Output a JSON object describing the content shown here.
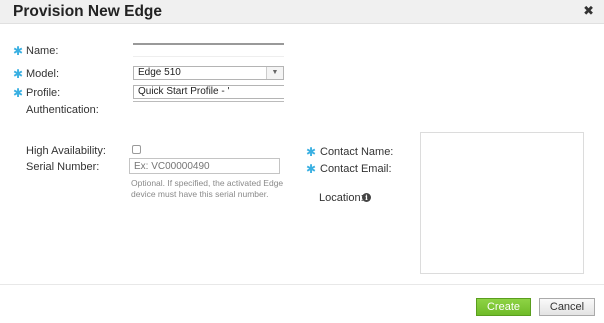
{
  "dialog": {
    "title": "Provision New Edge",
    "close_glyph": "✖"
  },
  "form": {
    "name": {
      "label": "Name:",
      "value": ""
    },
    "model": {
      "label": "Model:",
      "value": "Edge 510"
    },
    "profile": {
      "label": "Profile:",
      "value": "Quick Start Profile - '"
    },
    "authentication": {
      "label": "Authentication:",
      "value": ""
    },
    "high_availability": {
      "label": "High Availability:",
      "checked": false
    },
    "serial_number": {
      "label": "Serial Number:",
      "placeholder": "Ex: VC00000490",
      "hint_line1": "Optional. If specified, the activated Edge",
      "hint_line2": "device must have this serial number."
    },
    "contact_name": {
      "label": "Contact Name:"
    },
    "contact_email": {
      "label": "Contact Email:"
    },
    "location": {
      "label": "Location:"
    }
  },
  "icons": {
    "required": "required-asterisk-icon",
    "info": "info-icon",
    "dropdown": "chevron-down-icon"
  },
  "buttons": {
    "create": "Create",
    "cancel": "Cancel"
  },
  "colors": {
    "required": "#3ab0e2",
    "create_button": "#7cc536",
    "header_bg": "#f0f0f0"
  }
}
